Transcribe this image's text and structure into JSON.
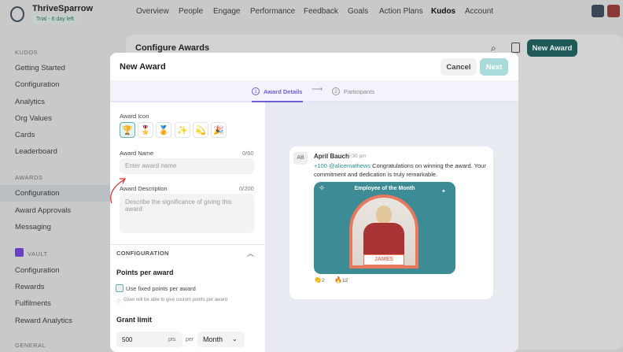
{
  "app": {
    "name": "ThriveSparrow",
    "trial": "Trial - 6 day left"
  },
  "nav": [
    "Overview",
    "People",
    "Engage",
    "Performance",
    "Feedback",
    "Goals",
    "Action Plans",
    "Kudos",
    "Account"
  ],
  "sidebar": {
    "kudos_heading": "KUDOS",
    "kudos": [
      "Getting Started",
      "Configuration",
      "Analytics",
      "Org Values",
      "Cards",
      "Leaderboard"
    ],
    "awards_heading": "AWARDS",
    "awards": [
      "Configuration",
      "Award Approvals",
      "Messaging"
    ],
    "vault_heading": "VAULT",
    "vault": [
      "Configuration",
      "Rewards",
      "Fulfilments",
      "Reward Analytics"
    ],
    "general_heading": "GENERAL"
  },
  "page": {
    "title": "Configure Awards",
    "new_award": "New Award"
  },
  "modal": {
    "title": "New Award",
    "cancel": "Cancel",
    "next": "Next",
    "steps": [
      {
        "num": "1",
        "label": "Award Details"
      },
      {
        "num": "2",
        "label": "Participants"
      }
    ],
    "award_icon_label": "Award Icon",
    "icons": [
      "🏆",
      "🎖️",
      "🏅",
      "✨",
      "💫",
      "🎉"
    ],
    "award_name_label": "Award Name",
    "award_name_count": "0/60",
    "award_name_placeholder": "Enter award name",
    "desc_label": "Award Description",
    "desc_count": "0/200",
    "desc_placeholder": "Describe the significance of giving this award",
    "config_heading": "CONFIGURATION",
    "points_heading": "Points per award",
    "fixed_points": "Use fixed points per award",
    "hint": "Giver will be able to give custom points per award",
    "grant_heading": "Grant limit",
    "grant_value": "500",
    "pts": "pts",
    "per": "per",
    "period": "Month"
  },
  "preview": {
    "initials": "AB",
    "author": "April Bauch",
    "time": "5:30 pm",
    "points": "+100",
    "mention": "@alicemathews",
    "message": "Congratulations on winning the award. Your commitment and dedication is truly remarkable.",
    "card_title": "Employee of the Month",
    "name": "JAMES",
    "reactions": [
      {
        "emoji": "👏",
        "count": "2"
      },
      {
        "emoji": "🔥",
        "count": "12"
      }
    ]
  }
}
